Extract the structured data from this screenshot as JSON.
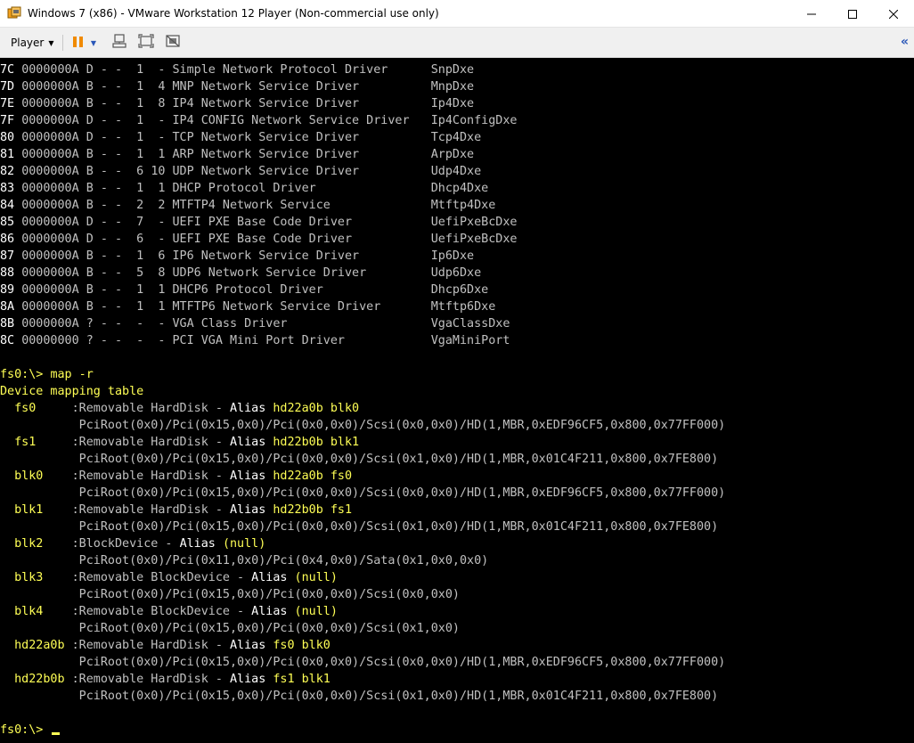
{
  "window": {
    "title": "Windows 7 (x86) - VMware Workstation 12 Player (Non-commercial use only)",
    "controls": [
      "minimize",
      "maximize",
      "close"
    ]
  },
  "toolbar": {
    "player_label": "Player",
    "icons": [
      "pause-icon",
      "dropdown-icon",
      "send-ctrl-alt-del-icon",
      "fullscreen-icon",
      "unity-icon"
    ],
    "collapse_glyph": "«"
  },
  "drivers": [
    {
      "handle": "7C",
      "version": "0000000A",
      "type": "D",
      "cfg": "-",
      "diag": "-",
      "children": "1",
      "devices": "-",
      "name": "Simple Network Protocol Driver",
      "image": "SnpDxe"
    },
    {
      "handle": "7D",
      "version": "0000000A",
      "type": "B",
      "cfg": "-",
      "diag": "-",
      "children": "1",
      "devices": "4",
      "name": "MNP Network Service Driver",
      "image": "MnpDxe"
    },
    {
      "handle": "7E",
      "version": "0000000A",
      "type": "B",
      "cfg": "-",
      "diag": "-",
      "children": "1",
      "devices": "8",
      "name": "IP4 Network Service Driver",
      "image": "Ip4Dxe"
    },
    {
      "handle": "7F",
      "version": "0000000A",
      "type": "D",
      "cfg": "-",
      "diag": "-",
      "children": "1",
      "devices": "-",
      "name": "IP4 CONFIG Network Service Driver",
      "image": "Ip4ConfigDxe"
    },
    {
      "handle": "80",
      "version": "0000000A",
      "type": "D",
      "cfg": "-",
      "diag": "-",
      "children": "1",
      "devices": "-",
      "name": "TCP Network Service Driver",
      "image": "Tcp4Dxe"
    },
    {
      "handle": "81",
      "version": "0000000A",
      "type": "B",
      "cfg": "-",
      "diag": "-",
      "children": "1",
      "devices": "1",
      "name": "ARP Network Service Driver",
      "image": "ArpDxe"
    },
    {
      "handle": "82",
      "version": "0000000A",
      "type": "B",
      "cfg": "-",
      "diag": "-",
      "children": "6",
      "devices": "10",
      "name": "UDP Network Service Driver",
      "image": "Udp4Dxe"
    },
    {
      "handle": "83",
      "version": "0000000A",
      "type": "B",
      "cfg": "-",
      "diag": "-",
      "children": "1",
      "devices": "1",
      "name": "DHCP Protocol Driver",
      "image": "Dhcp4Dxe"
    },
    {
      "handle": "84",
      "version": "0000000A",
      "type": "B",
      "cfg": "-",
      "diag": "-",
      "children": "2",
      "devices": "2",
      "name": "MTFTP4 Network Service",
      "image": "Mtftp4Dxe"
    },
    {
      "handle": "85",
      "version": "0000000A",
      "type": "D",
      "cfg": "-",
      "diag": "-",
      "children": "7",
      "devices": "-",
      "name": "UEFI PXE Base Code Driver",
      "image": "UefiPxeBcDxe"
    },
    {
      "handle": "86",
      "version": "0000000A",
      "type": "D",
      "cfg": "-",
      "diag": "-",
      "children": "6",
      "devices": "-",
      "name": "UEFI PXE Base Code Driver",
      "image": "UefiPxeBcDxe"
    },
    {
      "handle": "87",
      "version": "0000000A",
      "type": "B",
      "cfg": "-",
      "diag": "-",
      "children": "1",
      "devices": "6",
      "name": "IP6 Network Service Driver",
      "image": "Ip6Dxe"
    },
    {
      "handle": "88",
      "version": "0000000A",
      "type": "B",
      "cfg": "-",
      "diag": "-",
      "children": "5",
      "devices": "8",
      "name": "UDP6 Network Service Driver",
      "image": "Udp6Dxe"
    },
    {
      "handle": "89",
      "version": "0000000A",
      "type": "B",
      "cfg": "-",
      "diag": "-",
      "children": "1",
      "devices": "1",
      "name": "DHCP6 Protocol Driver",
      "image": "Dhcp6Dxe"
    },
    {
      "handle": "8A",
      "version": "0000000A",
      "type": "B",
      "cfg": "-",
      "diag": "-",
      "children": "1",
      "devices": "1",
      "name": "MTFTP6 Network Service Driver",
      "image": "Mtftp6Dxe"
    },
    {
      "handle": "8B",
      "version": "0000000A",
      "type": "?",
      "cfg": "-",
      "diag": "-",
      "children": "-",
      "devices": "-",
      "name": "VGA Class Driver",
      "image": "VgaClassDxe"
    },
    {
      "handle": "8C",
      "version": "00000000",
      "type": "?",
      "cfg": "-",
      "diag": "-",
      "children": "-",
      "devices": "-",
      "name": "PCI VGA Mini Port Driver",
      "image": "VgaMiniPort"
    }
  ],
  "prompt": "fs0:\\>",
  "command": "map -r",
  "mapping_header": "Device mapping table",
  "mappings": [
    {
      "name": "fs0",
      "desc": ":Removable HardDisk - ",
      "alias_label": "Alias",
      "alias": "hd22a0b blk0",
      "path": "PciRoot(0x0)/Pci(0x15,0x0)/Pci(0x0,0x0)/Scsi(0x0,0x0)/HD(1,MBR,0xEDF96CF5,0x800,0x77FF000)"
    },
    {
      "name": "fs1",
      "desc": ":Removable HardDisk - ",
      "alias_label": "Alias",
      "alias": "hd22b0b blk1",
      "path": "PciRoot(0x0)/Pci(0x15,0x0)/Pci(0x0,0x0)/Scsi(0x1,0x0)/HD(1,MBR,0x01C4F211,0x800,0x7FE800)"
    },
    {
      "name": "blk0",
      "desc": ":Removable HardDisk - ",
      "alias_label": "Alias",
      "alias": "hd22a0b fs0",
      "path": "PciRoot(0x0)/Pci(0x15,0x0)/Pci(0x0,0x0)/Scsi(0x0,0x0)/HD(1,MBR,0xEDF96CF5,0x800,0x77FF000)"
    },
    {
      "name": "blk1",
      "desc": ":Removable HardDisk - ",
      "alias_label": "Alias",
      "alias": "hd22b0b fs1",
      "path": "PciRoot(0x0)/Pci(0x15,0x0)/Pci(0x0,0x0)/Scsi(0x1,0x0)/HD(1,MBR,0x01C4F211,0x800,0x7FE800)"
    },
    {
      "name": "blk2",
      "desc": ":BlockDevice - ",
      "alias_label": "Alias",
      "alias": "(null)",
      "path": "PciRoot(0x0)/Pci(0x11,0x0)/Pci(0x4,0x0)/Sata(0x1,0x0,0x0)"
    },
    {
      "name": "blk3",
      "desc": ":Removable BlockDevice - ",
      "alias_label": "Alias",
      "alias": "(null)",
      "path": "PciRoot(0x0)/Pci(0x15,0x0)/Pci(0x0,0x0)/Scsi(0x0,0x0)"
    },
    {
      "name": "blk4",
      "desc": ":Removable BlockDevice - ",
      "alias_label": "Alias",
      "alias": "(null)",
      "path": "PciRoot(0x0)/Pci(0x15,0x0)/Pci(0x0,0x0)/Scsi(0x1,0x0)"
    },
    {
      "name": "hd22a0b",
      "desc": ":Removable HardDisk - ",
      "alias_label": "Alias",
      "alias": "fs0 blk0",
      "path": "PciRoot(0x0)/Pci(0x15,0x0)/Pci(0x0,0x0)/Scsi(0x0,0x0)/HD(1,MBR,0xEDF96CF5,0x800,0x77FF000)"
    },
    {
      "name": "hd22b0b",
      "desc": ":Removable HardDisk - ",
      "alias_label": "Alias",
      "alias": "fs1 blk1",
      "path": "PciRoot(0x0)/Pci(0x15,0x0)/Pci(0x0,0x0)/Scsi(0x1,0x0)/HD(1,MBR,0x01C4F211,0x800,0x7FE800)"
    }
  ],
  "final_prompt": "fs0:\\>",
  "colors": {
    "terminal_bg": "#000000",
    "text": "#c0c0c0",
    "highlight": "#ffff55",
    "white": "#ffffff"
  }
}
